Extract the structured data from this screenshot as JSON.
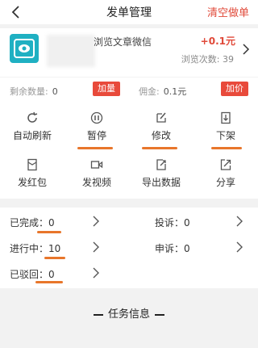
{
  "header": {
    "title": "发单管理",
    "clear_label": "清空做单"
  },
  "task_card": {
    "title": "浏览文章微信",
    "price": "+0.1元",
    "views_label": "浏览次数: 39"
  },
  "stats": {
    "remaining_label": "剩余数量",
    "remaining_value": "0",
    "add_qty_label": "加量",
    "commission_label": "佣金",
    "commission_value": "0.1元",
    "add_price_label": "加价"
  },
  "actions": [
    {
      "label": "自动刷新",
      "icon": "refresh-icon"
    },
    {
      "label": "暂停",
      "icon": "pause-icon"
    },
    {
      "label": "修改",
      "icon": "edit-icon"
    },
    {
      "label": "下架",
      "icon": "delist-icon"
    },
    {
      "label": "发红包",
      "icon": "red-packet-icon"
    },
    {
      "label": "发视频",
      "icon": "video-icon"
    },
    {
      "label": "导出数据",
      "icon": "export-icon"
    },
    {
      "label": "分享",
      "icon": "share-icon"
    }
  ],
  "status": {
    "completed": "已完成：0",
    "in_progress": "进行中：10",
    "rejected": "已驳回：0",
    "complaint": "投诉：0",
    "appeal": "申诉：0"
  },
  "section_title": "任务信息",
  "colors": {
    "accent": "#e04a3a",
    "underline": "#e8762b",
    "app_icon": "#1fb0c2"
  }
}
